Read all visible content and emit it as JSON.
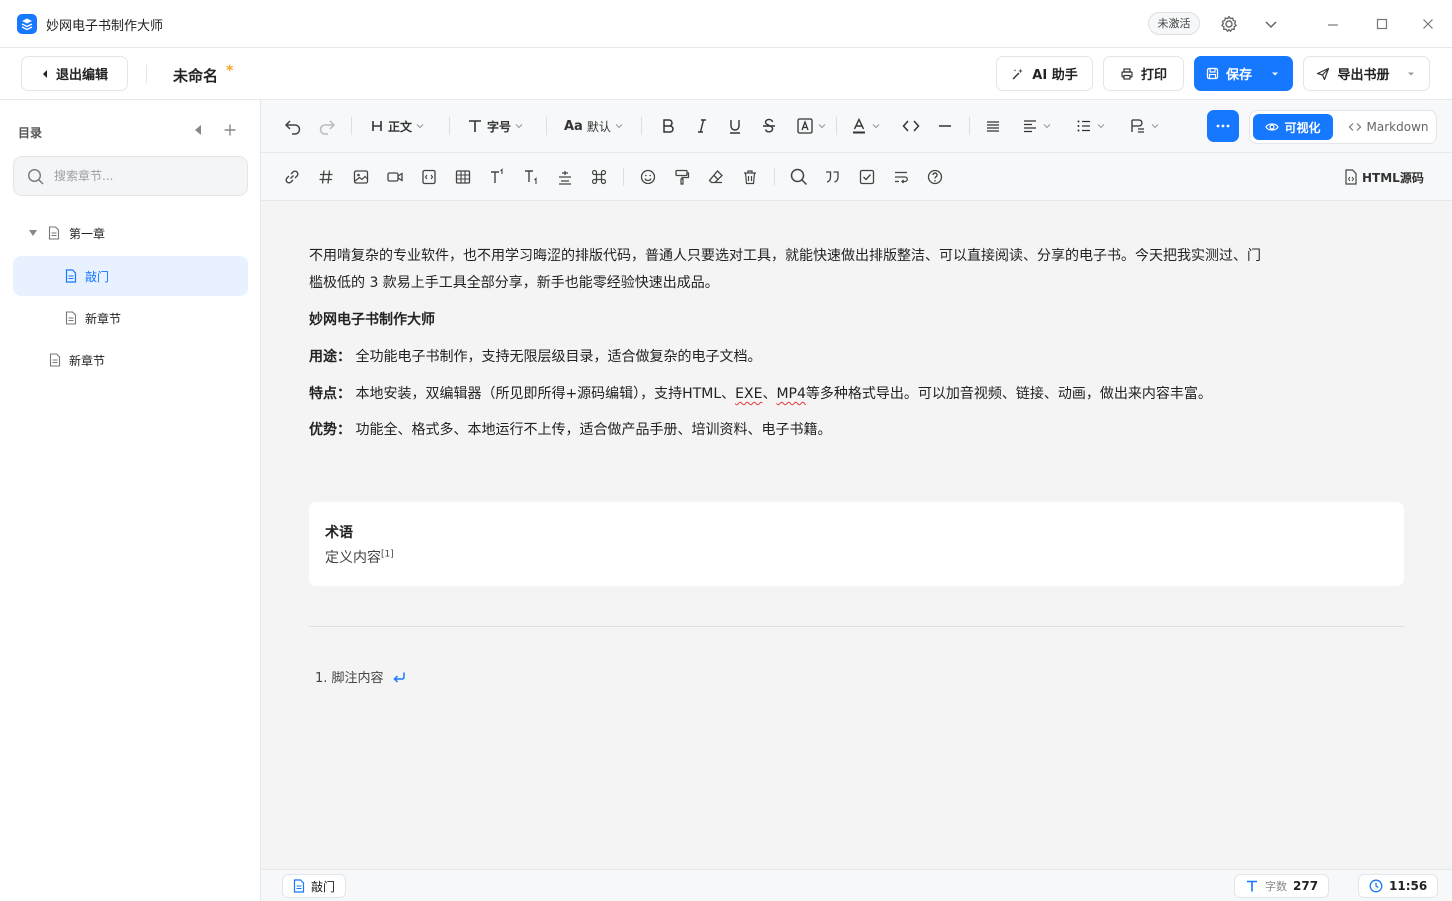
{
  "app": {
    "title": "妙网电子书制作大师",
    "activate_label": "未激活"
  },
  "actionbar": {
    "exit_label": "退出编辑",
    "doc_title": "未命名",
    "unsaved_mark": "*",
    "ai_label": "AI 助手",
    "print_label": "打印",
    "save_label": "保存",
    "export_label": "导出书册"
  },
  "sidebar": {
    "title": "目录",
    "search_placeholder": "搜索章节...",
    "items": [
      {
        "label": "第一章",
        "level": 0,
        "expanded": true
      },
      {
        "label": "敲门",
        "level": 1,
        "active": true
      },
      {
        "label": "新章节",
        "level": 1
      },
      {
        "label": "新章节",
        "level": 0
      }
    ]
  },
  "toolbar": {
    "paragraph_style": "正文",
    "font_size": "字号",
    "font_family": "默认",
    "mode_visual": "可视化",
    "mode_markdown": "Markdown",
    "html_source": "HTML源码"
  },
  "content": {
    "intro_line1": "不用啃复杂的专业软件，也不用学习晦涩的排版代码，普通人只要选对工具，就能快速做出排版整洁、可以直接阅读、分享的电子书。今天把我实测过、门",
    "intro_line2": "槛极低的 3 款易上手工具全部分享，新手也能零经验快速出成品。",
    "heading": "妙网电子书制作大师",
    "usage_label": "用途：",
    "usage_text": " 全功能电子书制作，支持无限层级目录，适合做复杂的电子文档。",
    "feature_label": "特点：",
    "feature_text_a": " 本地安装，双编辑器（所见即所得+源码编辑），支持HTML、",
    "feature_exe": "EXE",
    "feature_sep": "、",
    "feature_mp4": "MP4",
    "feature_text_b": "等多种格式导出。可以加音视频、链接、动画，做出来内容丰富。",
    "advantage_label": "优势：",
    "advantage_text": " 功能全、格式多、本地运行不上传，适合做产品手册、培训资料、电子书籍。",
    "term_title": "术语",
    "term_def": "定义内容",
    "term_ref": "[1]",
    "footnote_text": "1. 脚注内容"
  },
  "statusbar": {
    "section": "敲门",
    "word_count_label": "字数",
    "word_count": "277",
    "time": "11:56"
  },
  "colors": {
    "accent": "#1677ff",
    "unsaved": "#f5a623"
  }
}
